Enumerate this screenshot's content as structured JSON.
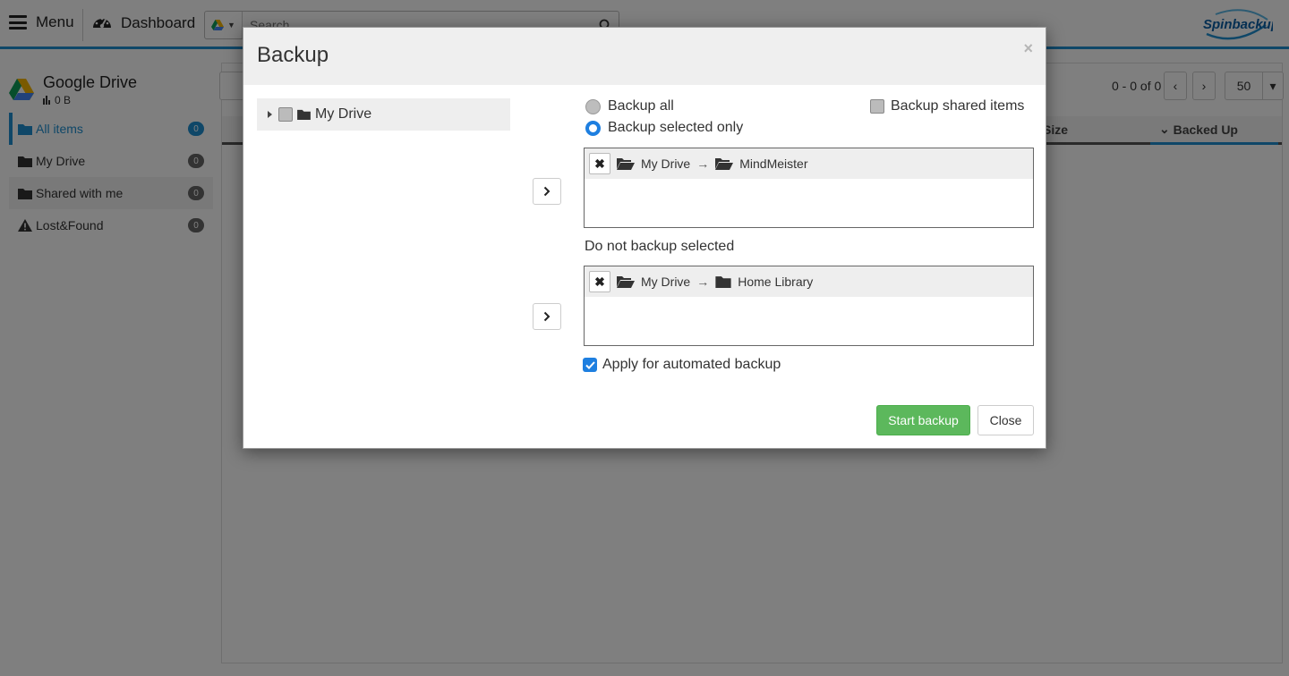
{
  "topbar": {
    "menu_label": "Menu",
    "dashboard_label": "Dashboard",
    "search_placeholder": "Search",
    "logo_text": "Spinbackup",
    "accent_color": "#1e8fd0"
  },
  "sidebar": {
    "title": "Google Drive",
    "size": "0 B",
    "items": [
      {
        "label": "All items",
        "count": "0",
        "icon": "folder-icon"
      },
      {
        "label": "My Drive",
        "count": "0",
        "icon": "folder-icon"
      },
      {
        "label": "Shared with me",
        "count": "0",
        "icon": "folder-icon"
      },
      {
        "label": "Lost&Found",
        "count": "0",
        "icon": "warning-icon"
      }
    ]
  },
  "listing": {
    "pager_text": "0 - 0 of 0",
    "per_page": "50",
    "columns": [
      "Size",
      "Backed Up"
    ]
  },
  "modal": {
    "title": "Backup",
    "close_symbol": "×",
    "tree": {
      "root_label": "My Drive"
    },
    "options": {
      "backup_all": "Backup all",
      "backup_selected_only": "Backup selected only",
      "selected_option": "backup_selected_only",
      "backup_shared_items": "Backup shared items"
    },
    "backup_selected": [
      {
        "parent": "My Drive",
        "arrow": "→",
        "child": "MindMeister"
      }
    ],
    "do_not_backup_label": "Do not backup selected",
    "do_not_backup": [
      {
        "parent": "My Drive",
        "arrow": "→",
        "child": "Home Library"
      }
    ],
    "remove_symbol": "✖",
    "apply_automated_label": "Apply for automated backup",
    "apply_automated_checked": true,
    "start_button": "Start backup",
    "close_button": "Close",
    "start_color": "#5cb85c"
  }
}
